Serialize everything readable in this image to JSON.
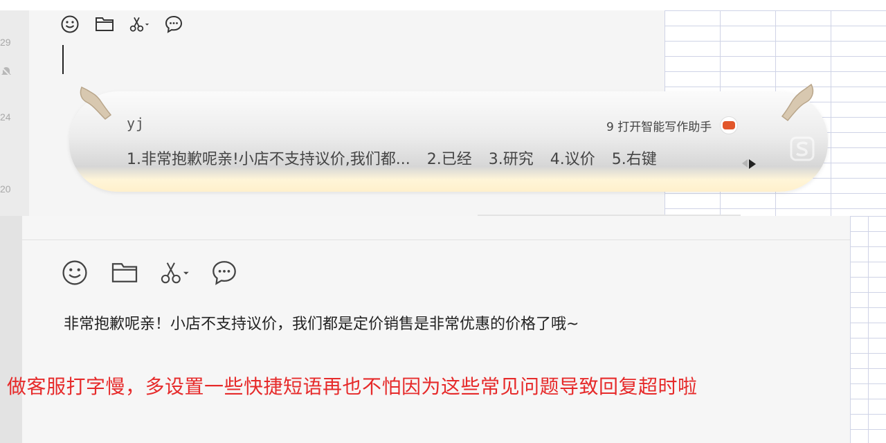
{
  "colors": {
    "caption_red": "#e62a2a",
    "grid_line": "#cfd3e6",
    "panel_bg": "#f5f5f5"
  },
  "top_screenshot": {
    "side_numbers": [
      "29",
      "24",
      "20"
    ],
    "toolbar_icons": [
      "emoji-icon",
      "folder-icon",
      "scissors-icon",
      "chat-bubble-icon"
    ],
    "ime": {
      "input_text": "yj",
      "assistant_label": "9 打开智能写作助手",
      "candidates": [
        "1.非常抱歉呢亲!小店不支持议价,我们都...",
        "2.已经",
        "3.研究",
        "4.议价",
        "5.右键"
      ]
    }
  },
  "bottom_screenshot": {
    "toolbar_icons": [
      "emoji-icon",
      "folder-icon",
      "scissors-icon",
      "chat-bubble-icon"
    ],
    "message_text": "非常抱歉呢亲！小店不支持议价，我们都是定价销售是非常优惠的价格了哦~"
  },
  "caption": "做客服打字慢，多设置一些快捷短语再也不怕因为这些常见问题导致回复超时啦"
}
